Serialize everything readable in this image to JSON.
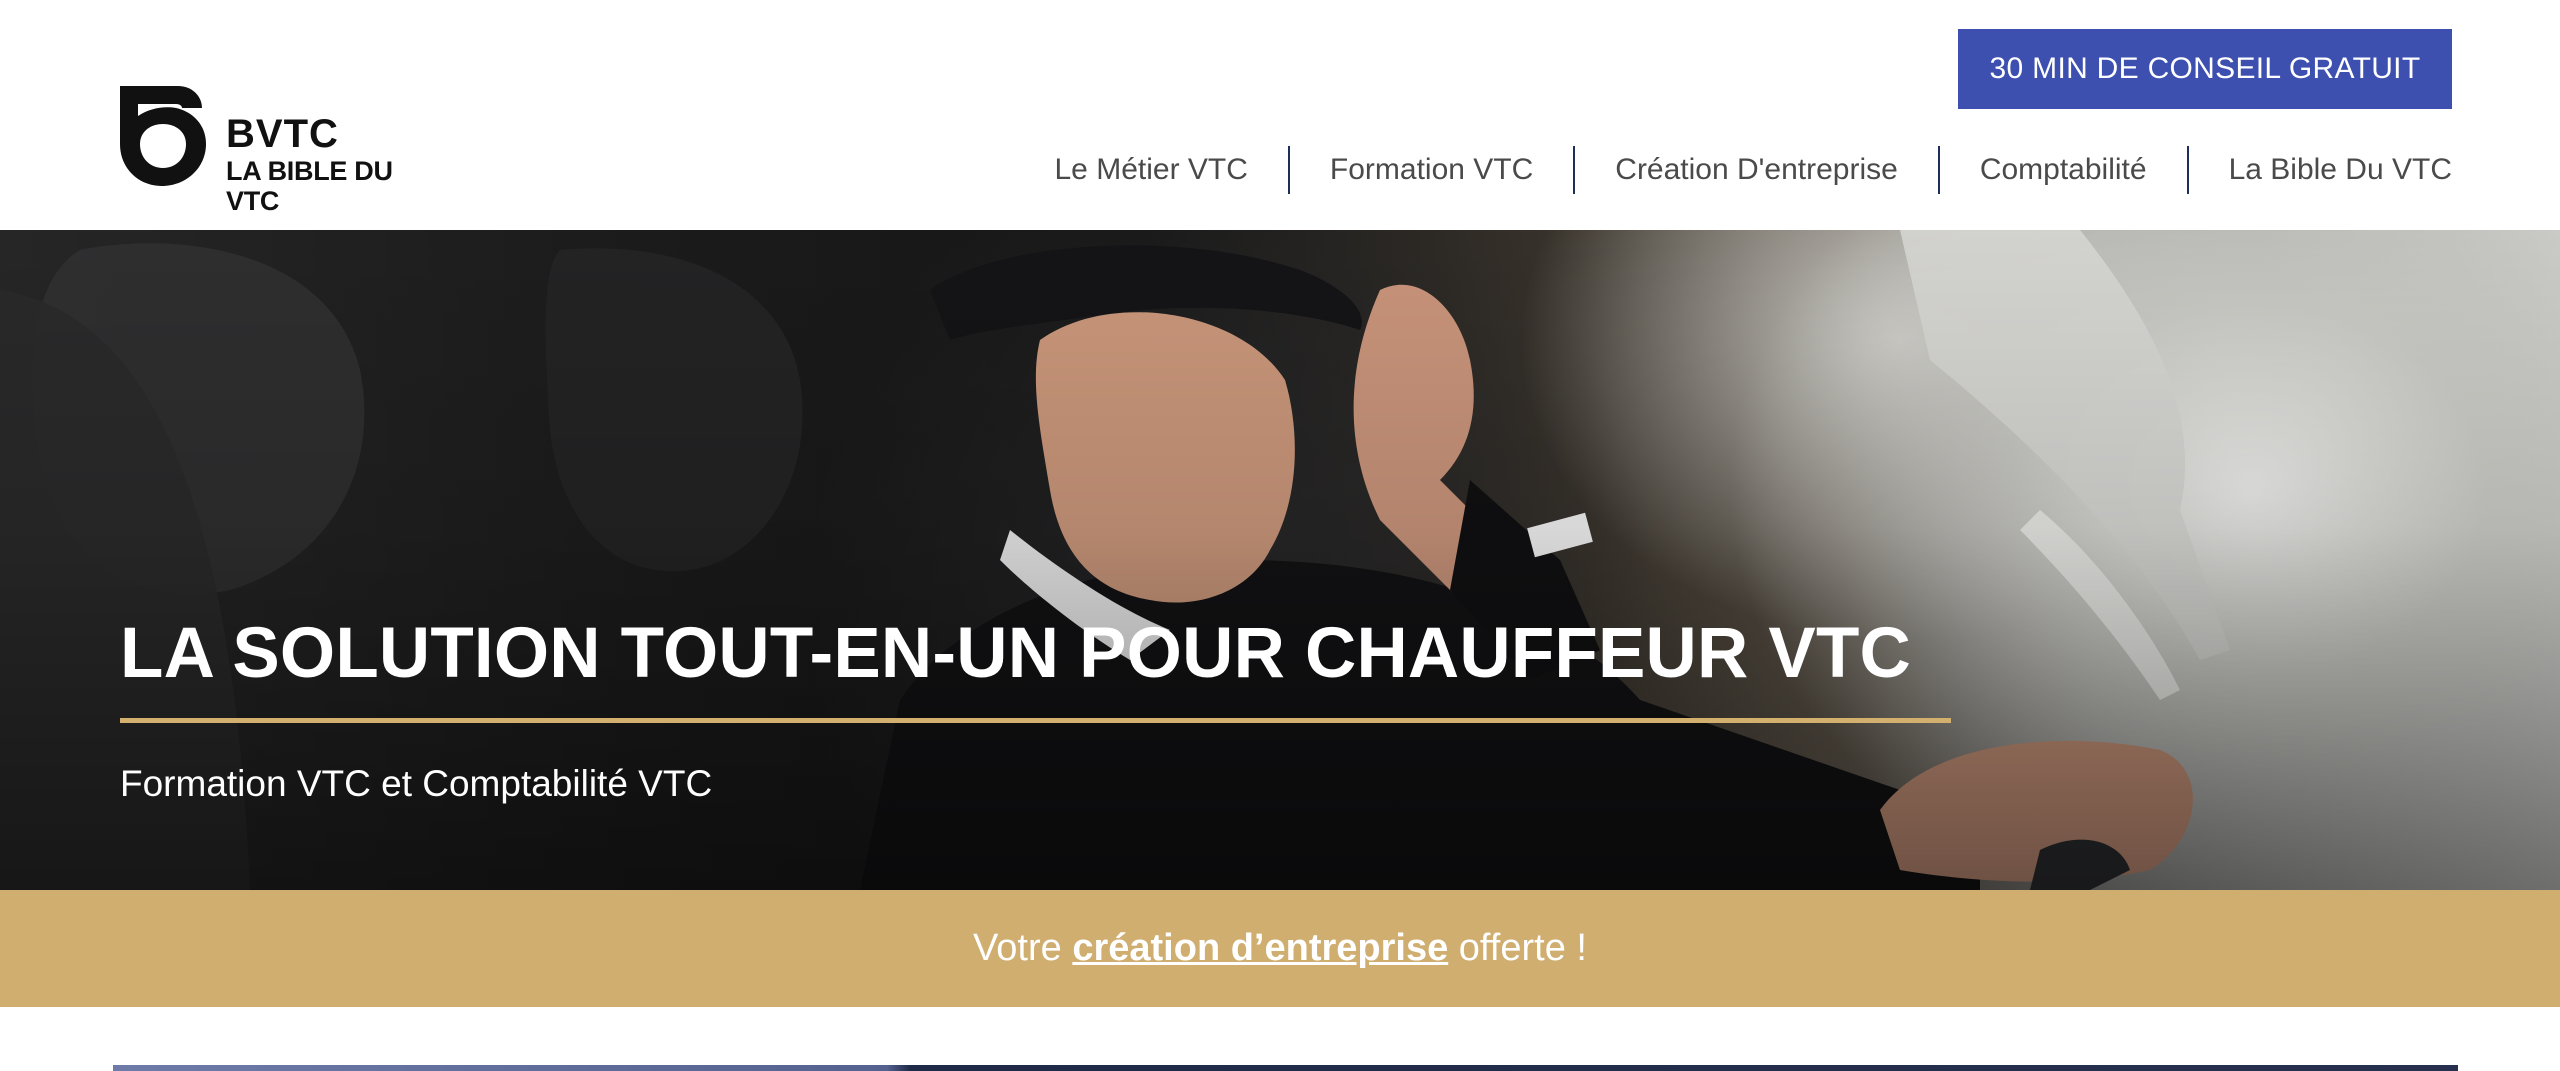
{
  "header": {
    "logo": {
      "icon": "bvtc-b-logo-icon",
      "name": "BVTC",
      "tagline": "LA BIBLE DU VTC"
    },
    "cta_label": "30 MIN DE CONSEIL GRATUIT",
    "nav": [
      {
        "label": "Le Métier VTC"
      },
      {
        "label": "Formation VTC"
      },
      {
        "label": "Création D'entreprise"
      },
      {
        "label": "Comptabilité"
      },
      {
        "label": "La Bible Du VTC"
      }
    ]
  },
  "hero": {
    "title": "LA SOLUTION TOUT-EN-UN POUR CHAUFFEUR VTC",
    "subtitle": "Formation VTC et Comptabilité VTC",
    "image": "chauffeur-in-car-photo"
  },
  "banner": {
    "prefix": "Votre ",
    "link": "création d’entreprise",
    "suffix": " offerte !"
  },
  "colors": {
    "cta": "#3d50b0",
    "nav_separator": "#1d2d5c",
    "accent_gold": "#cfae70",
    "hero_rule": "#d4b06e"
  }
}
